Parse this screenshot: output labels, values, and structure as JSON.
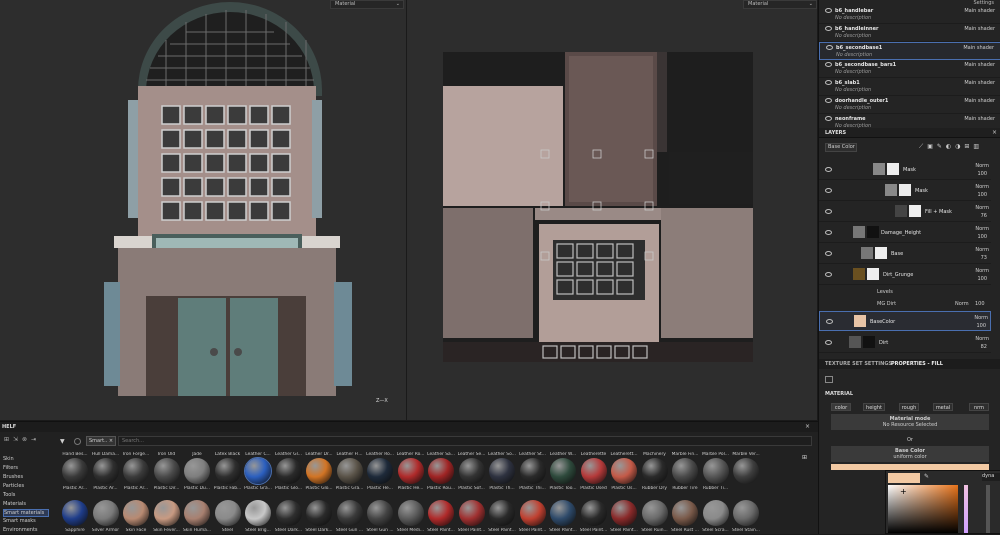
{
  "viewport3d": {
    "mode": "Material",
    "axis": "Z—X"
  },
  "viewport2d": {
    "mode": "Material"
  },
  "texture_sets": {
    "settings_label": "Settings",
    "items": [
      {
        "name": "b6_handlebar",
        "desc": "No description",
        "shader": "Main shader"
      },
      {
        "name": "b6_handleinner",
        "desc": "No description",
        "shader": "Main shader"
      },
      {
        "name": "b6_secondbase1",
        "desc": "No description",
        "shader": "Main shader"
      },
      {
        "name": "b6_secondbase_bars1",
        "desc": "No description",
        "shader": "Main shader"
      },
      {
        "name": "b6_slab1",
        "desc": "No description",
        "shader": "Main shader"
      },
      {
        "name": "doorhandle_outer1",
        "desc": "No description",
        "shader": "Main shader"
      },
      {
        "name": "neonframe",
        "desc": "No description",
        "shader": "Main shader"
      }
    ]
  },
  "layers": {
    "title": "LAYERS",
    "channel": "Base Color",
    "items": [
      {
        "name": "Mask",
        "blend": "Norm",
        "opacity": "100"
      },
      {
        "name": "Mask",
        "blend": "Norm",
        "opacity": "100"
      },
      {
        "name": "Fill + Mask",
        "blend": "Norm",
        "opacity": "76"
      },
      {
        "name": "Damage_Height",
        "blend": "Norm",
        "opacity": "100"
      },
      {
        "name": "Base",
        "blend": "Norm",
        "opacity": "73"
      },
      {
        "name": "Dirt_Grunge",
        "blend": "Norm",
        "opacity": "100"
      },
      {
        "name": "BaseColor",
        "blend": "Norm",
        "opacity": "100"
      },
      {
        "name": "Dirt",
        "blend": "Norm",
        "opacity": "82"
      }
    ],
    "effects": [
      {
        "name": "Levels"
      },
      {
        "name": "MG Dirt",
        "blend": "Norm",
        "opacity": "100"
      }
    ]
  },
  "properties": {
    "tab1": "TEXTURE SET SETTINGS",
    "tab2": "PROPERTIES - FILL",
    "section": "MATERIAL",
    "chips": [
      "color",
      "height",
      "rough",
      "metal",
      "nrm"
    ],
    "material_mode": "Material mode",
    "no_resource": "No Resource Selected",
    "or": "Or",
    "base_color": "Base Color",
    "uniform_color": "uniform color",
    "swatch_color": "#f2c9a3",
    "picker_label": "dyna"
  },
  "shelf": {
    "title": "HELF",
    "search_placeholder": "Search...",
    "filter_tag": "Smart..",
    "categories": [
      "Skin",
      "Filters",
      "Brushes",
      "Particles",
      "Tools",
      "Materials",
      "Smart materials",
      "Smart masks",
      "Environments"
    ],
    "row1": [
      "Hand Bes...",
      "Hull Dama...",
      "Iron Forge...",
      "Iron Old",
      "Jade",
      "Latex Black",
      "Leather C...",
      "Leather Gl...",
      "Leather Dr...",
      "Leather Fl...",
      "Leather Ro...",
      "Leather Ro...",
      "Leather Sa...",
      "Leather Se...",
      "Leather So...",
      "Leather St...",
      "Leather W...",
      "Leatherette",
      "Leatherett...",
      "Machinery",
      "Marble Fin...",
      "Marble Pol...",
      "Marble Ver..."
    ],
    "row2": [
      "Plastic Ar...",
      "Plastic Ar...",
      "Plastic Ar...",
      "Plastic Dir...",
      "Plastic Du...",
      "Plastic Fab...",
      "Plastic Gra...",
      "Plastic Glo...",
      "Plastic Glo...",
      "Plastic Gra...",
      "Plastic He...",
      "Plastic He...",
      "Plastic Rou...",
      "Plastic Sof...",
      "Plastic Th...",
      "Plastic Thi...",
      "Plastic Too...",
      "Plastic Used",
      "Plastic Us...",
      "Rubber Dry",
      "Rubber Tire",
      "Rubber Ti..."
    ],
    "row3": [
      "Sapphire",
      "Silver Armor",
      "Skin Face",
      "Skin Fever...",
      "Skin Huma...",
      "Steel",
      "Steel Brig...",
      "Steel Dark...",
      "Steel Dark...",
      "Steel Gun ...",
      "Steel Gun ...",
      "Steel Medi...",
      "Steel Paint...",
      "Steel Paint...",
      "Steel Paint...",
      "Steel Paint...",
      "Steel Paint...",
      "Steel Paint...",
      "Steel Paint...",
      "Steel Ruin...",
      "Steel Rust ...",
      "Steel Scra...",
      "Steel Stain..."
    ],
    "row1_colors": [
      "#3a3a3a",
      "#2f2f2f",
      "#3b3b3b",
      "#4a4a4a",
      "#7e7e7e",
      "#2e2e2e",
      "#2b5fbf",
      "#2a2a2a",
      "#d27424",
      "#5a5348",
      "#1e2a3a",
      "#b02a2a",
      "#a02424",
      "#333333",
      "#2e3240",
      "#2a2a2a",
      "#2e4a3c",
      "#b53a3a",
      "#c45a48",
      "#2a2a2a",
      "#4a4a4a",
      "#555555",
      "#3e3e3e"
    ],
    "row3_colors": [
      "#1f3d8a",
      "#7a7a7a",
      "#b88a72",
      "#c89a82",
      "#a88070",
      "#8a8a8a",
      "#c8c8c8",
      "#2e2e2e",
      "#2a2a2a",
      "#3a3a3a",
      "#444444",
      "#5a5a5a",
      "#b02a2a",
      "#a03030",
      "#2a2a2a",
      "#c04030",
      "#2e4a6a",
      "#2a2a2a",
      "#8a2a2a",
      "#6a6a6a",
      "#7a5a4a",
      "#8a8a8a",
      "#6a6a6a"
    ]
  }
}
